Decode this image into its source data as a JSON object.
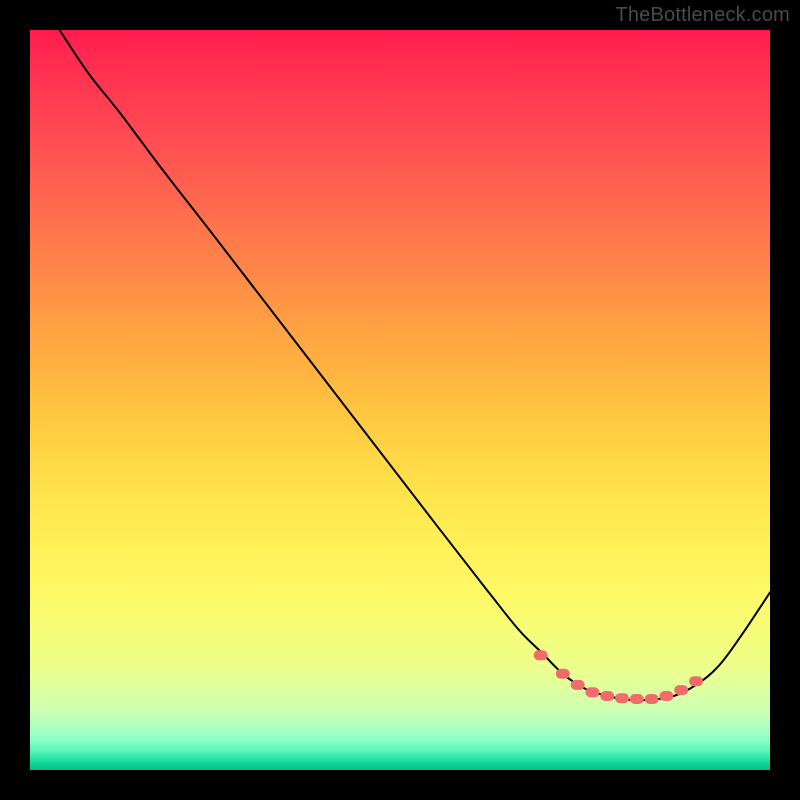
{
  "watermark": "TheBottleneck.com",
  "chart_data": {
    "type": "line",
    "title": "",
    "xlabel": "",
    "ylabel": "",
    "xlim": [
      0,
      100
    ],
    "ylim": [
      0,
      100
    ],
    "series": [
      {
        "name": "bottleneck-curve",
        "x": [
          4,
          8,
          12,
          18,
          25,
          35,
          45,
          55,
          62,
          66,
          69,
          72,
          75,
          78,
          81,
          84,
          87,
          90,
          93,
          96,
          100
        ],
        "y": [
          100,
          94,
          89,
          81,
          72,
          59,
          46,
          33,
          24,
          19,
          16,
          13,
          11,
          10,
          9.5,
          9.5,
          10,
          11.5,
          14,
          18,
          24
        ]
      }
    ],
    "markers": {
      "name": "highlight-points",
      "color": "#f26b6b",
      "x": [
        69,
        72,
        74,
        76,
        78,
        80,
        82,
        84,
        86,
        88,
        90
      ],
      "y": [
        15.5,
        13,
        11.5,
        10.5,
        10,
        9.7,
        9.6,
        9.6,
        10,
        10.8,
        12
      ]
    }
  }
}
